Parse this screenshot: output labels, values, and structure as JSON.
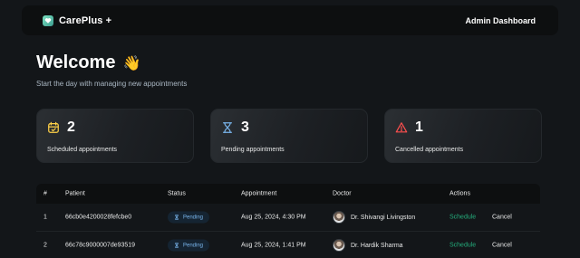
{
  "header": {
    "brand": "CarePlus +",
    "admin_label": "Admin Dashboard"
  },
  "welcome": {
    "title": "Welcome",
    "emoji": "👋",
    "subtitle": "Start the day with managing new appointments"
  },
  "stats": [
    {
      "count": "2",
      "label": "Scheduled appointments",
      "icon": "calendar-icon",
      "color": "#ffd147"
    },
    {
      "count": "3",
      "label": "Pending appointments",
      "icon": "hourglass-icon",
      "color": "#79b5ec"
    },
    {
      "count": "1",
      "label": "Cancelled appointments",
      "icon": "alert-triangle-icon",
      "color": "#ff4f4e"
    }
  ],
  "table": {
    "columns": [
      "#",
      "Patient",
      "Status",
      "Appointment",
      "Doctor",
      "Actions"
    ],
    "rows": [
      {
        "num": "1",
        "patient": "66cb0e4200028fefcbe0",
        "status": "Pending",
        "appointment": "Aug 25, 2024, 4:30 PM",
        "doctor": "Dr. Shivangi Livingston",
        "schedule": "Schedule",
        "cancel": "Cancel"
      },
      {
        "num": "2",
        "patient": "66c78c9000007de93519",
        "status": "Pending",
        "appointment": "Aug 25, 2024, 1:41 PM",
        "doctor": "Dr. Hardik Sharma",
        "schedule": "Schedule",
        "cancel": "Cancel"
      }
    ]
  }
}
